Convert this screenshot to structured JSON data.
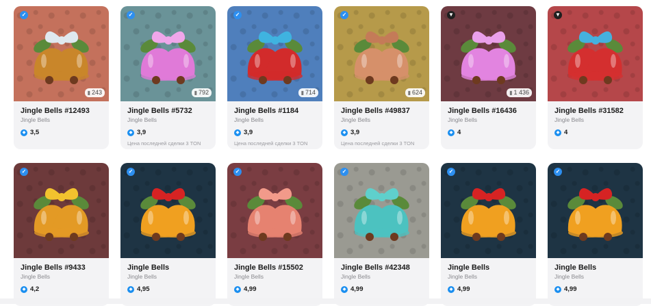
{
  "colors": {
    "card_bg": "#f3f3f5",
    "ton_blue": "#1b8ff0"
  },
  "cards": [
    {
      "title": "Jingle Bells #12493",
      "subtitle": "Jingle Bells",
      "price": "3,5",
      "supply": "243",
      "last_sale": "",
      "bg": "#c4715c",
      "bell": "#c9862a",
      "bow": "#dfe8ef",
      "badge": "verified-icon"
    },
    {
      "title": "Jingle Bells #5732",
      "subtitle": "Jingle Bells",
      "price": "3,9",
      "supply": "792",
      "last_sale": "Цена последней сделки 3 TON",
      "bg": "#6a9398",
      "bell": "#e07ad8",
      "bow": "#f0a6ea",
      "badge": "verified-icon"
    },
    {
      "title": "Jingle Bells #1184",
      "subtitle": "Jingle Bells",
      "price": "3,9",
      "supply": "714",
      "last_sale": "Цена последней сделки 3 TON",
      "bg": "#4f7fbc",
      "bell": "#d22b2b",
      "bow": "#3fb3e0",
      "badge": "verified-icon"
    },
    {
      "title": "Jingle Bells #49837",
      "subtitle": "Jingle Bells",
      "price": "3,9",
      "supply": "624",
      "last_sale": "Цена последней сделки 3 TON",
      "bg": "#b69a4a",
      "bell": "#d6906a",
      "bow": "#c47b58",
      "badge": "verified-icon"
    },
    {
      "title": "Jingle Bells #16436",
      "subtitle": "Jingle Bells",
      "price": "4",
      "supply": "1 436",
      "last_sale": "",
      "bg": "#6e3b42",
      "bell": "#e284e0",
      "bow": "#eaa0ea",
      "badge": "premium-icon"
    },
    {
      "title": "Jingle Bells #31582",
      "subtitle": "Jingle Bells",
      "price": "4",
      "supply": "",
      "last_sale": "",
      "bg": "#b5474a",
      "bell": "#d42f2f",
      "bow": "#45b1df",
      "badge": "premium-icon"
    },
    {
      "title": "Jingle Bells #9433",
      "subtitle": "Jingle Bells",
      "price": "4,2",
      "supply": "",
      "last_sale": "",
      "bg": "#6d3a3b",
      "bell": "#e39a25",
      "bow": "#f2c22e",
      "badge": "verified-icon"
    },
    {
      "title": "Jingle Bells",
      "subtitle": "Jingle Bells",
      "price": "4,95",
      "supply": "",
      "last_sale": "",
      "bg": "#1e3444",
      "bell": "#f0a020",
      "bow": "#d62323",
      "badge": "verified-icon"
    },
    {
      "title": "Jingle Bells #15502",
      "subtitle": "Jingle Bells",
      "price": "4,99",
      "supply": "",
      "last_sale": "",
      "bg": "#7a3d42",
      "bell": "#e68270",
      "bow": "#f29a8a",
      "badge": "verified-icon"
    },
    {
      "title": "Jingle Bells #42348",
      "subtitle": "Jingle Bells",
      "price": "4,99",
      "supply": "",
      "last_sale": "",
      "bg": "#9a9a92",
      "bell": "#4cc2c0",
      "bow": "#5fd0cc",
      "badge": "verified-icon"
    },
    {
      "title": "Jingle Bells",
      "subtitle": "Jingle Bells",
      "price": "4,99",
      "supply": "",
      "last_sale": "",
      "bg": "#1e3444",
      "bell": "#f0a020",
      "bow": "#d62323",
      "badge": "verified-icon"
    },
    {
      "title": "Jingle Bells",
      "subtitle": "Jingle Bells",
      "price": "4,99",
      "supply": "",
      "last_sale": "",
      "bg": "#1e3444",
      "bell": "#f0a020",
      "bow": "#d62323",
      "badge": "verified-icon"
    }
  ]
}
